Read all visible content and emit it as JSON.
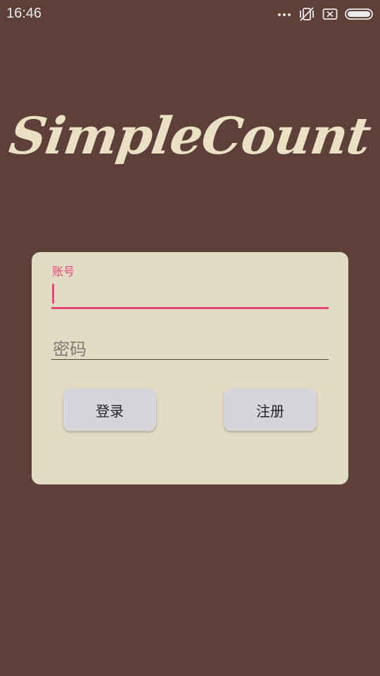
{
  "status_bar": {
    "time": "16:46",
    "icons": [
      "more-dots-icon",
      "vibrate-off-icon",
      "sim-error-icon",
      "battery-icon"
    ]
  },
  "app": {
    "title": "SimpleCount"
  },
  "login_form": {
    "account_label": "账号",
    "account_value": "",
    "password_placeholder": "密码",
    "password_value": "",
    "login_button": "登录",
    "register_button": "注册"
  },
  "colors": {
    "background": "#5d4037",
    "card": "#e3dcc4",
    "accent": "#e8457b",
    "logo": "#e9e0c6",
    "button": "#d6d5d9"
  }
}
